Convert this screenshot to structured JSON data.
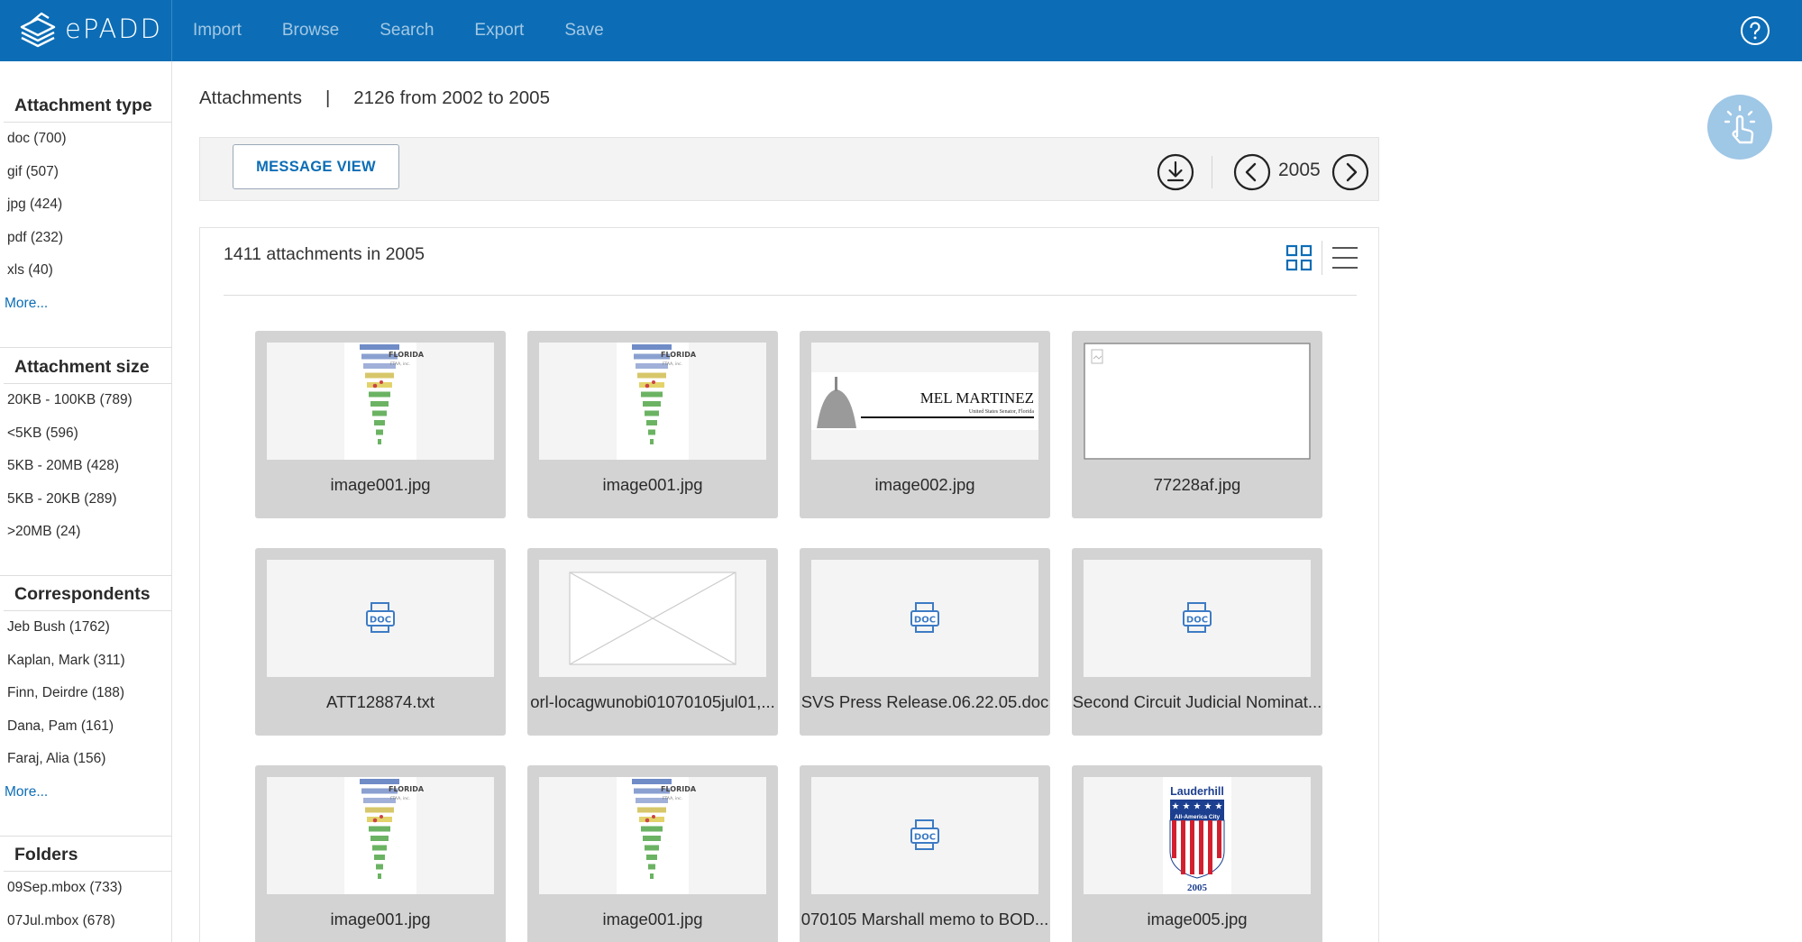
{
  "app": {
    "brand": "ePADD"
  },
  "nav": [
    "Import",
    "Browse",
    "Search",
    "Export",
    "Save"
  ],
  "sidebar": {
    "attachment_type": {
      "title": "Attachment type",
      "items": [
        "doc (700)",
        "gif (507)",
        "jpg (424)",
        "pdf (232)",
        "xls (40)"
      ],
      "more": "More..."
    },
    "attachment_size": {
      "title": "Attachment size",
      "items": [
        "20KB - 100KB (789)",
        "<5KB (596)",
        "5KB - 20MB (428)",
        "5KB - 20KB (289)",
        ">20MB (24)"
      ]
    },
    "correspondents": {
      "title": "Correspondents",
      "items": [
        "Jeb Bush (1762)",
        "Kaplan, Mark (311)",
        "Finn, Deirdre (188)",
        "Dana, Pam (161)",
        "Faraj, Alia (156)"
      ],
      "more": "More..."
    },
    "folders": {
      "title": "Folders",
      "items": [
        "09Sep.mbox (733)",
        "07Jul.mbox (678)"
      ]
    }
  },
  "breadcrumb": {
    "section": "Attachments",
    "separator": "|",
    "summary": "2126 from 2002 to 2005"
  },
  "toolbar": {
    "message_view": "MESSAGE VIEW",
    "year": "2005"
  },
  "panel": {
    "heading": "1411 attachments in 2005"
  },
  "attachments": [
    {
      "name": "image001.jpg",
      "thumb": "florida-logo"
    },
    {
      "name": "image001.jpg",
      "thumb": "florida-logo"
    },
    {
      "name": "image002.jpg",
      "thumb": "martinez-banner",
      "banner_title": "MEL MARTINEZ",
      "banner_sub": "United States Senator, Florida"
    },
    {
      "name": "77228af.jpg",
      "thumb": "broken-image"
    },
    {
      "name": "ATT128874.txt",
      "thumb": "doc-icon"
    },
    {
      "name": "orl-locagwunobi01070105jul01,...",
      "thumb": "placeholder-x"
    },
    {
      "name": "SVS Press Release.06.22.05.doc",
      "thumb": "doc-icon"
    },
    {
      "name": "Second Circuit Judicial Nominat...",
      "thumb": "doc-icon"
    },
    {
      "name": "image001.jpg",
      "thumb": "florida-logo"
    },
    {
      "name": "image001.jpg",
      "thumb": "florida-logo"
    },
    {
      "name": "070105 Marshall memo to BOD...",
      "thumb": "doc-icon"
    },
    {
      "name": "image005.jpg",
      "thumb": "lauderhill-logo",
      "logo_title": "Lauderhill",
      "logo_sub": "All-America City",
      "logo_year": "2005"
    }
  ],
  "colors": {
    "brand_blue": "#0c6db6",
    "card_bg": "#d3d3d3",
    "fab": "#9fc7e6"
  },
  "icons": {
    "brand": "stacked-papers-icon",
    "help": "help-circle-icon",
    "download": "download-circle-icon",
    "prev": "chevron-left-circle-icon",
    "next": "chevron-right-circle-icon",
    "grid": "grid-view-icon",
    "list": "list-view-icon",
    "fab": "tap-hand-icon"
  }
}
